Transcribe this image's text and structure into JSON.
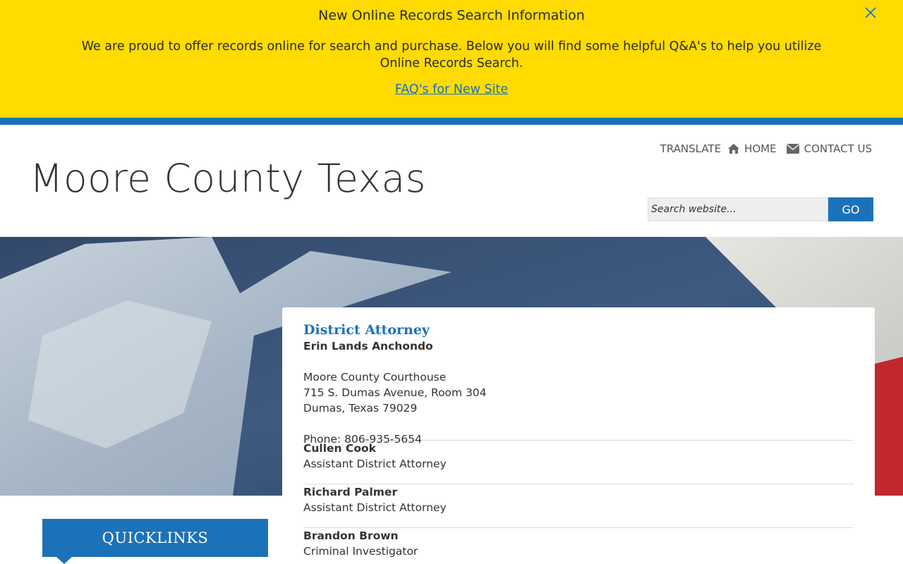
{
  "alert": {
    "title": "New Online Records Search Information",
    "body": "We are proud to offer records online for search and purchase.  Below you will find some helpful Q&A's to help you utilize Online Records Search.",
    "link": "FAQ's for New Site",
    "close_icon": "close-icon"
  },
  "header": {
    "site_title": "Moore County Texas",
    "nav": {
      "translate": "TRANSLATE",
      "home": "HOME",
      "contact": "CONTACT US"
    },
    "search": {
      "placeholder": "Search website...",
      "button": "GO"
    }
  },
  "card": {
    "title": "District Attorney",
    "name": "Erin Lands Anchondo",
    "address": [
      "Moore County Courthouse",
      "715 S. Dumas Avenue, Room 304",
      "Dumas, Texas 79029"
    ],
    "phone": "Phone: 806-935-5654",
    "staff": [
      {
        "name": "Cullen Cook",
        "role": "Assistant District Attorney"
      },
      {
        "name": "Richard Palmer",
        "role": "Assistant District Attorney"
      },
      {
        "name": "Brandon Brown",
        "role": "Criminal Investigator"
      }
    ]
  },
  "sidebar": {
    "quicklinks": "QUICKLINKS"
  },
  "colors": {
    "alert_bg": "#ffdb00",
    "brand_blue": "#1c72b8",
    "link_blue": "#1a6fb5"
  }
}
